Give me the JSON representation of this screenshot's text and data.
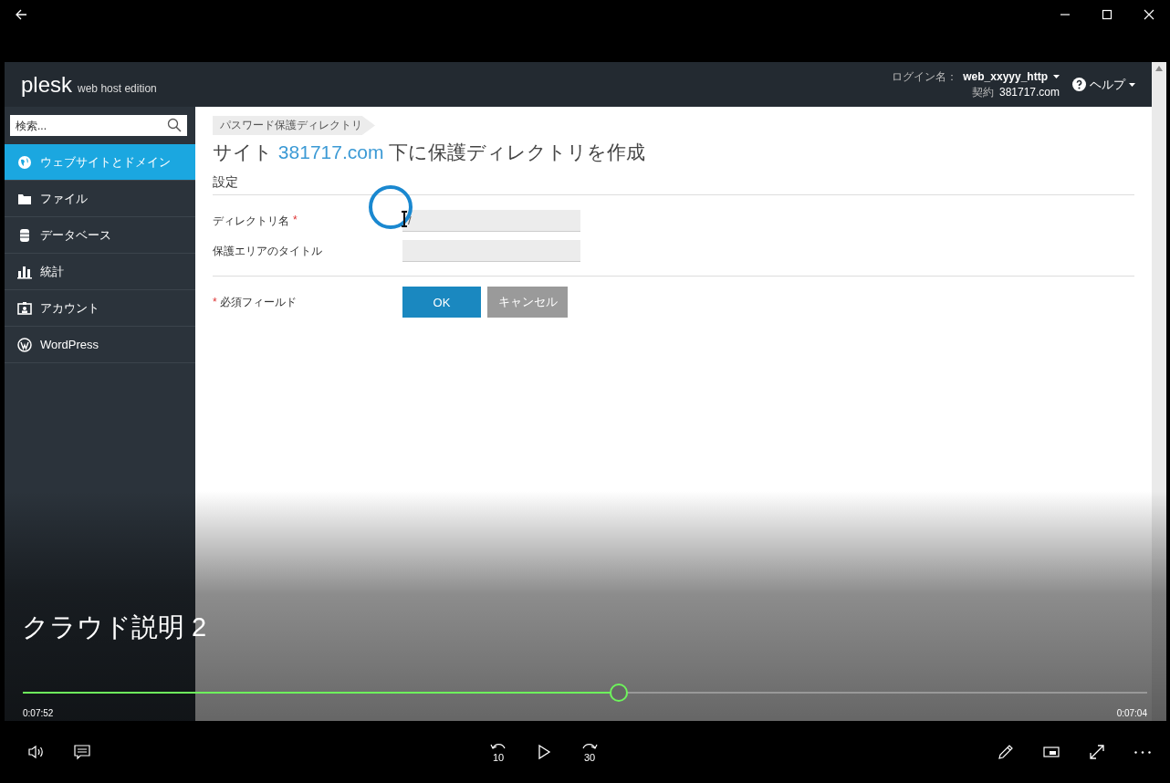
{
  "player": {
    "title": "クラウド説明 2",
    "elapsed": "0:07:52",
    "remaining": "0:07:04",
    "seek": {
      "level": 0.53
    },
    "skip_back": "10",
    "skip_forward": "30"
  },
  "plesk": {
    "brand": "plesk",
    "edition": "web host edition",
    "login_label": "ログイン名：",
    "login_user": "web_xxyyy_http",
    "contract_label": "契約",
    "contract_domain": "381717.com",
    "help": "ヘルプ",
    "search": {
      "placeholder": "検索..."
    },
    "nav": [
      {
        "label": "ウェブサイトとドメイン",
        "selected": true
      },
      {
        "label": "ファイル",
        "selected": false
      },
      {
        "label": "データベース",
        "selected": false
      },
      {
        "label": "統計",
        "selected": false
      },
      {
        "label": "アカウント",
        "selected": false
      },
      {
        "label": "WordPress",
        "selected": false
      }
    ],
    "breadcrumb": "パスワード保護ディレクトリ",
    "heading": {
      "prefix": "サイト",
      "domain": "381717.com",
      "suffix": "下に保護ディレクトリを作成"
    },
    "section": "設定",
    "fields": [
      {
        "label": "ディレクトリ名",
        "required_mark": "*",
        "value": "/"
      },
      {
        "label": "保護エリアのタイトル"
      }
    ],
    "required_note": {
      "mark": "*",
      "text": "必須フィールド"
    },
    "buttons": [
      {
        "label": "OK",
        "kind": "primary"
      },
      {
        "label": "キャンセル",
        "kind": "secondary"
      }
    ]
  }
}
